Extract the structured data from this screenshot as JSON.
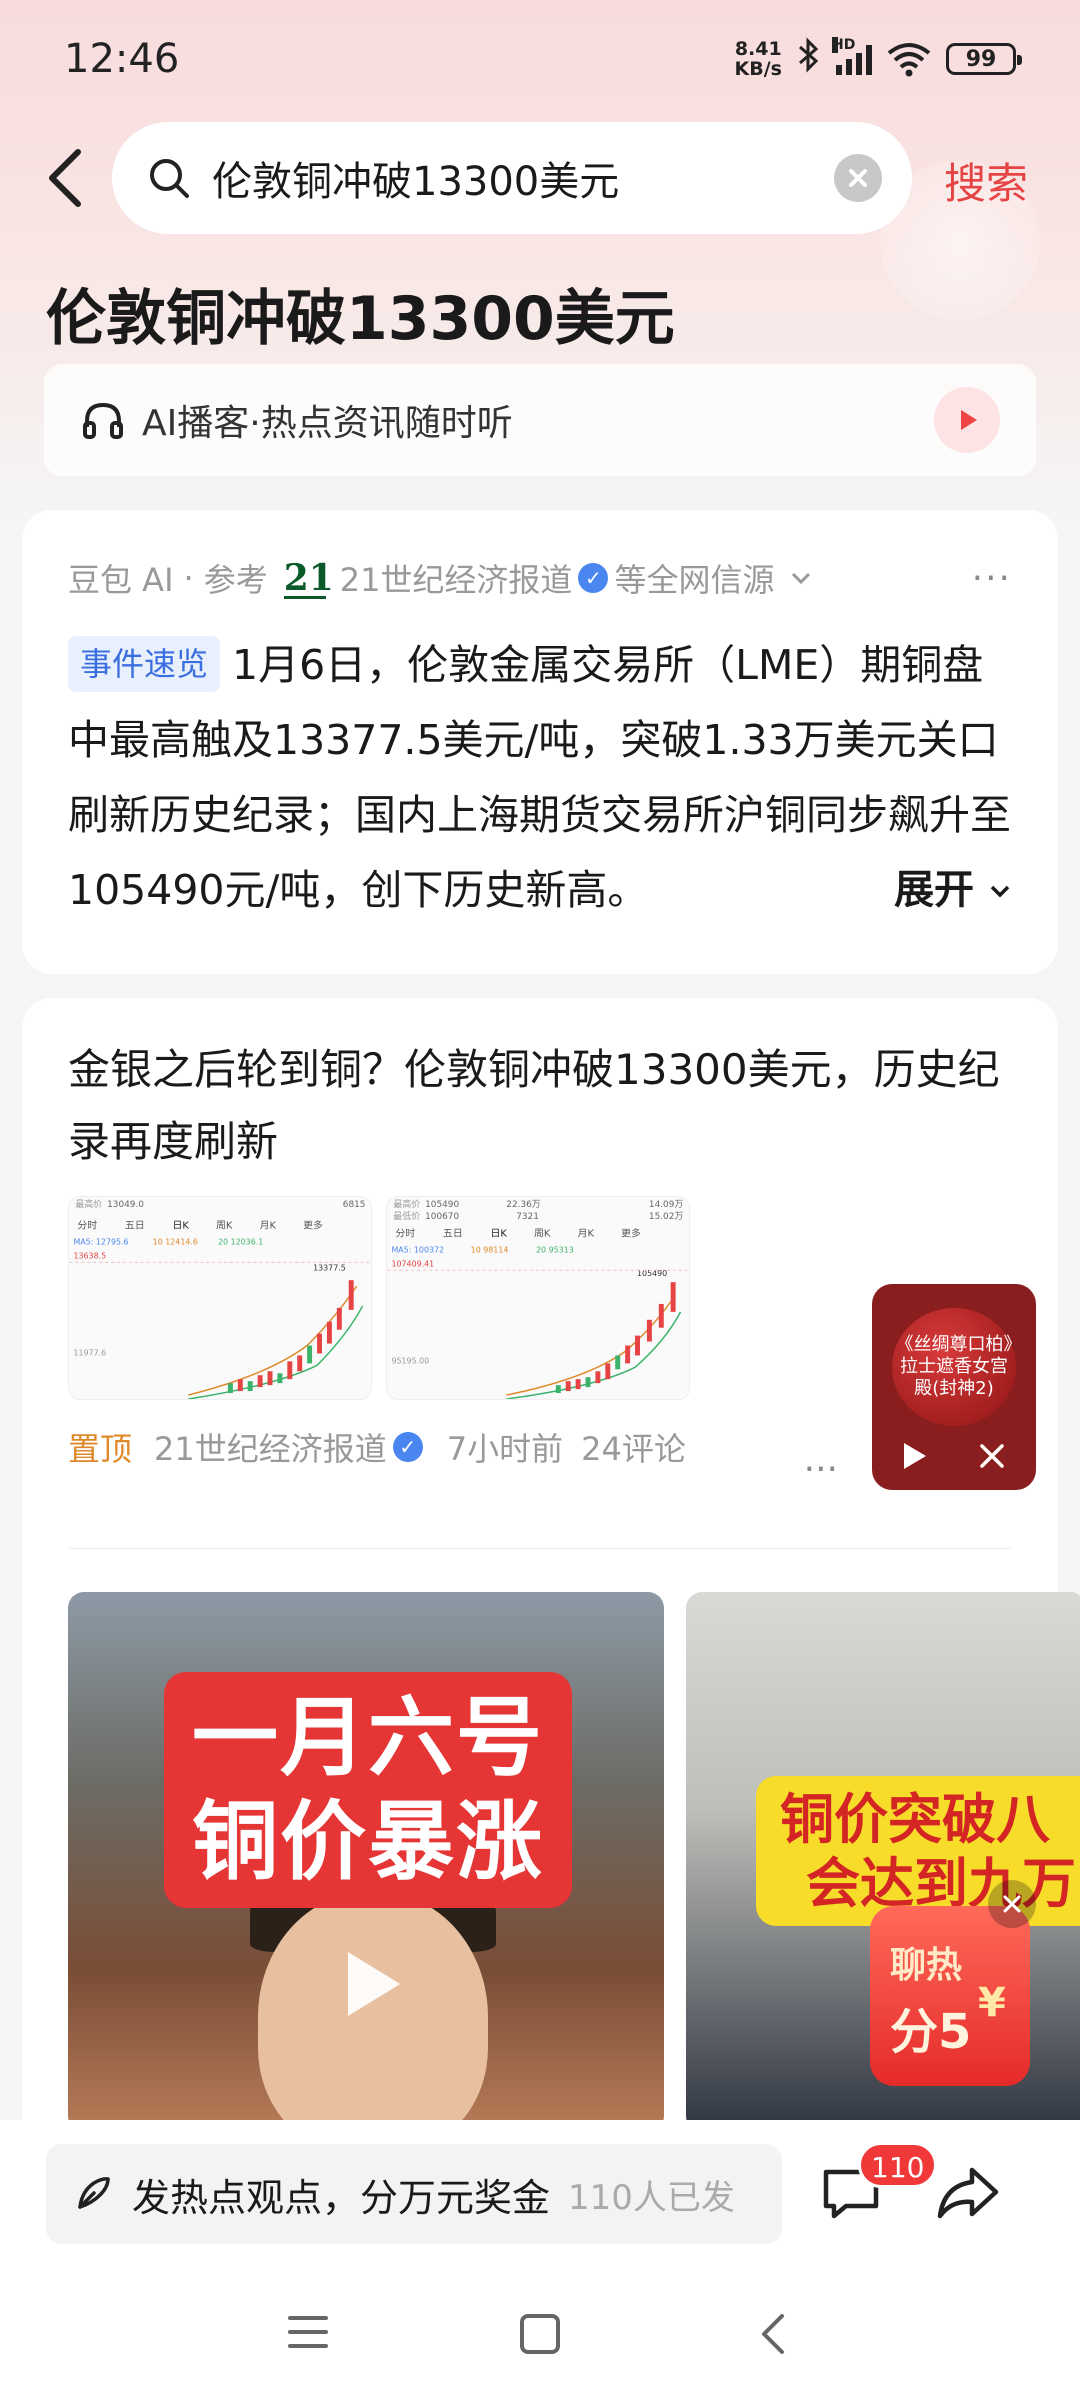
{
  "status_bar": {
    "time": "12:46",
    "net_speed_value": "8.41",
    "net_speed_unit": "KB/s",
    "signal_label": "HD",
    "battery": "99"
  },
  "search": {
    "query": "伦敦铜冲破13300美元",
    "button_label": "搜索"
  },
  "page_title": "伦敦铜冲破13300美元",
  "podcast": {
    "label": "AI播客·热点资讯随时听"
  },
  "ai_summary": {
    "provider": "豆包 AI",
    "ref_label": "参考",
    "source_name": "21世纪经济报道",
    "source_suffix": "等全网信源",
    "tag": "事件速览",
    "body": "1月6日，伦敦金属交易所（LME）期铜盘中最高触及13377.5美元/吨，突破1.33万美元关口刷新历史纪录；国内上海期货交易所沪铜同步飙升至105490元/吨，创下历史新高。",
    "expand_label": "展开"
  },
  "news_item": {
    "title": "金银之后轮到铜？伦敦铜冲破13300美元，历史纪录再度刷新",
    "pin_label": "置顶",
    "source": "21世纪经济报道",
    "time": "7小时前",
    "comments": "24评论",
    "thumb_1": {
      "row1_label": "最高价",
      "row1_value": "13049.0",
      "tabs": [
        "分时",
        "五日",
        "日K",
        "周K",
        "月K",
        "更多"
      ],
      "ma_label": "MA5: 12795.6",
      "ma10": "10 12414.6",
      "ma20": "20 12036.1",
      "top_price": "13638.5",
      "peak": "13377.5",
      "low_price": "11977.6",
      "right_val": "6815"
    },
    "thumb_2": {
      "row1_label": "最高价",
      "row1_value": "105490",
      "row2_label": "最低价",
      "row2_value": "100670",
      "tabs": [
        "分时",
        "五日",
        "日K",
        "周K",
        "月K",
        "更多"
      ],
      "ma_label": "MA5: 100372",
      "ma10": "10 98114",
      "ma20": "20 95313",
      "top_price": "107409.41",
      "peak": "105490",
      "low_price": "95195.00",
      "mid1": "22.36万",
      "mid2": "7321",
      "right1": "14.09万",
      "right2": "15.02万"
    }
  },
  "videos": [
    {
      "banner_line1": "一月六号",
      "banner_line2": "铜价暴涨"
    },
    {
      "banner_line1": "铜价突破八",
      "banner_line2": "会达到九万"
    }
  ],
  "mini_player": {
    "art_text": "《丝绸尊口柏》拉士遮香女宫殿(封神2)"
  },
  "red_packet": {
    "line1": "聊热",
    "line2": "分5",
    "currency": "¥"
  },
  "bottom_bar": {
    "comment_placeholder": "发热点观点，分万元奖金",
    "participants": "110人已发",
    "chat_badge": "110"
  },
  "colors": {
    "accent_red": "#e64444",
    "pin_orange": "#e0892a",
    "tag_blue": "#3b6fe0",
    "badge_red": "#f03838"
  }
}
